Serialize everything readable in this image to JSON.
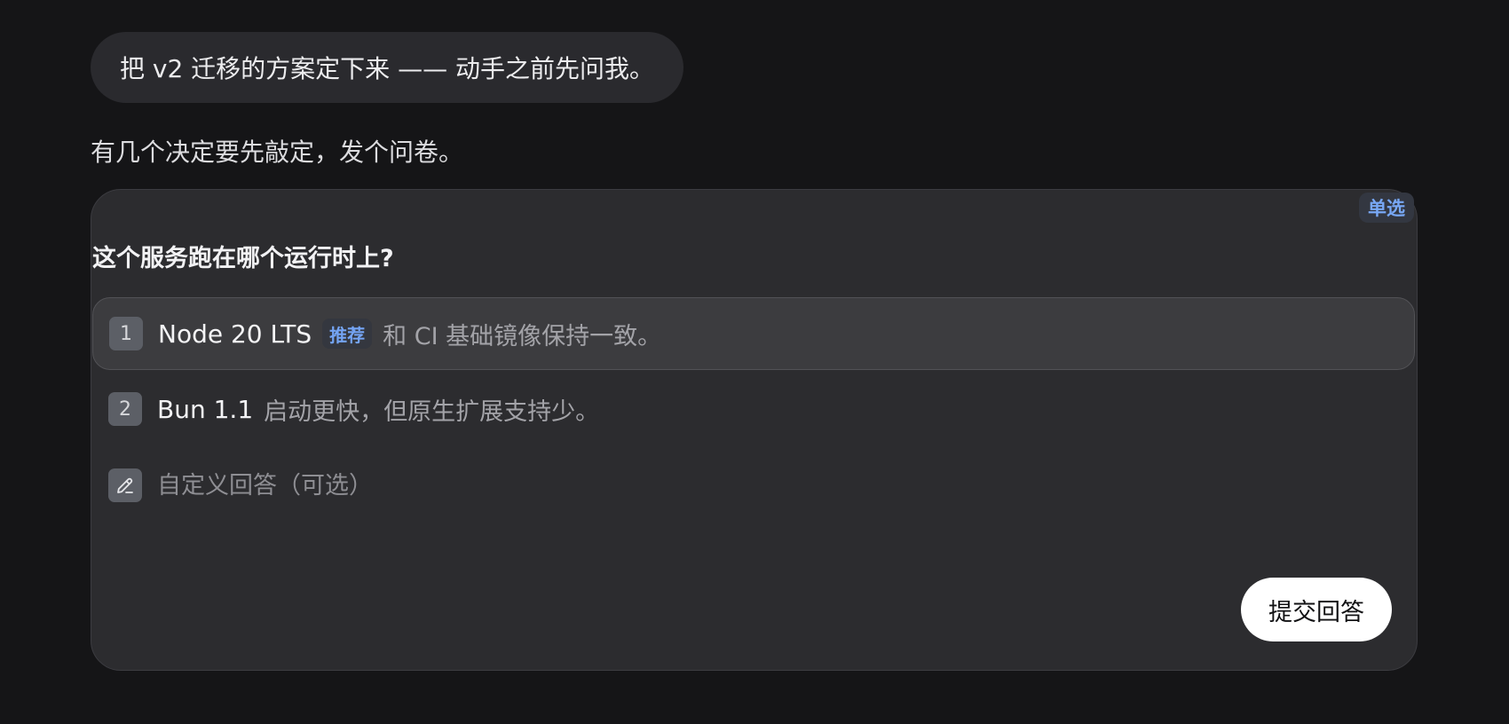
{
  "conversation": {
    "user_message": "把 v2 迁移的方案定下来 —— 动手之前先问我。",
    "assistant_message": "有几个决定要先敲定，发个问卷。"
  },
  "questionnaire": {
    "type_label": "单选",
    "question": "这个服务跑在哪个运行时上?",
    "options": [
      {
        "number": "1",
        "name": "Node 20 LTS",
        "badge": "推荐",
        "description": "和 CI 基础镜像保持一致。",
        "selected": true
      },
      {
        "number": "2",
        "name": "Bun 1.1",
        "badge": "",
        "description": "启动更快，但原生扩展支持少。",
        "selected": false
      }
    ],
    "custom_answer": {
      "icon": "pencil-icon",
      "placeholder": "自定义回答（可选）",
      "value": ""
    },
    "submit_label": "提交回答"
  },
  "colors": {
    "background": "#151517",
    "card": "#2c2c2f",
    "selected_option": "#3c3c3f",
    "accent_blue": "#74a4f4",
    "submit_button": "#ffffff"
  }
}
